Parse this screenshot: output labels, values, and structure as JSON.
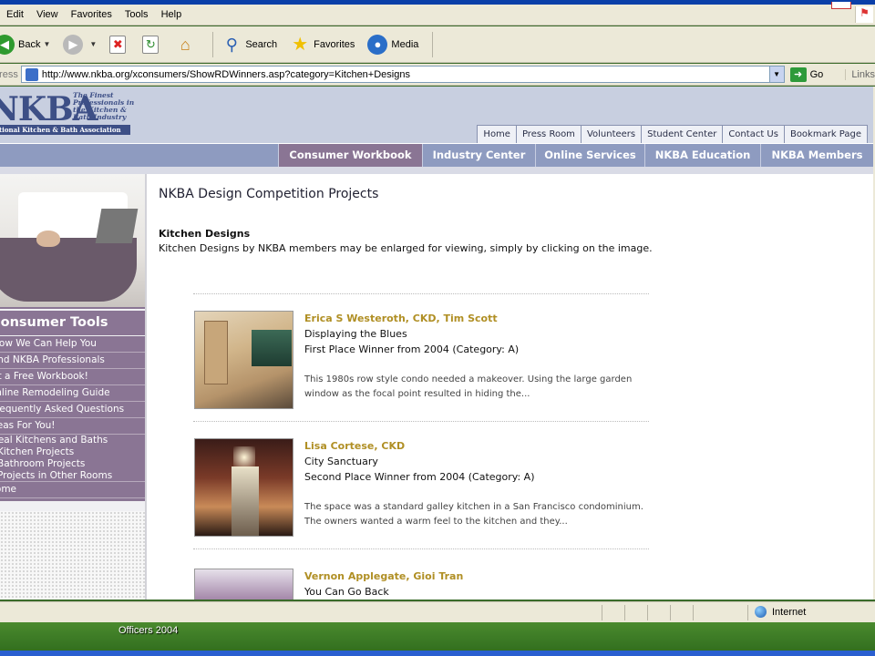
{
  "browser": {
    "menu": [
      "Edit",
      "View",
      "Favorites",
      "Tools",
      "Help"
    ],
    "toolbar": {
      "back": "Back",
      "search": "Search",
      "favorites": "Favorites",
      "media": "Media"
    },
    "address_label": "Address",
    "url": "http://www.nkba.org/xconsumers/ShowRDWinners.asp?category=Kitchen+Designs",
    "go": "Go",
    "links": "Links",
    "status_zone": "Internet"
  },
  "site": {
    "logo_text": "NKBA",
    "logo_tagline": "The Finest Professionals in the Kitchen & Bath Industry",
    "logo_org": "National Kitchen & Bath Association",
    "top_links": [
      "Home",
      "Press Room",
      "Volunteers",
      "Student Center",
      "Contact Us",
      "Bookmark Page"
    ],
    "nav": [
      {
        "label": "Consumer Workbook",
        "active": true
      },
      {
        "label": "Industry Center",
        "active": false
      },
      {
        "label": "Online Services",
        "active": false
      },
      {
        "label": "NKBA Education",
        "active": false
      },
      {
        "label": "NKBA Members",
        "active": false
      }
    ]
  },
  "sidebar": {
    "title": "Consumer Tools",
    "items": [
      "How We Can Help You",
      "Find NKBA Professionals",
      "Get a Free Workbook!",
      "Online Remodeling Guide",
      "Frequently Asked Questions",
      "Ideas For You!",
      "Real Kitchens and Baths",
      "Kitchen Projects",
      "Bathroom Projects",
      "Projects in Other Rooms",
      "Home"
    ]
  },
  "main": {
    "page_title": "NKBA Design Competition Projects",
    "section_title": "Kitchen Designs",
    "section_desc": "Kitchen Designs by NKBA members may be enlarged for viewing, simply by clicking on the image.",
    "entries": [
      {
        "designer": "Erica S Westeroth, CKD, Tim Scott",
        "title": "Displaying the Blues",
        "award": "First Place Winner from 2004 (Category: A)",
        "desc": "This 1980s row style condo needed a makeover. Using the large garden window as the focal point resulted in hiding the..."
      },
      {
        "designer": "Lisa Cortese, CKD",
        "title": "City Sanctuary",
        "award": "Second Place Winner from 2004 (Category: A)",
        "desc": "The space was a standard galley kitchen in a San Francisco condominium. The owners wanted a warm feel to the kitchen and they..."
      },
      {
        "designer": "Vernon Applegate, Gioi Tran",
        "title": "You Can Go Back",
        "award": "",
        "desc": ""
      }
    ]
  },
  "desktop": {
    "label": "Officers 2004"
  }
}
